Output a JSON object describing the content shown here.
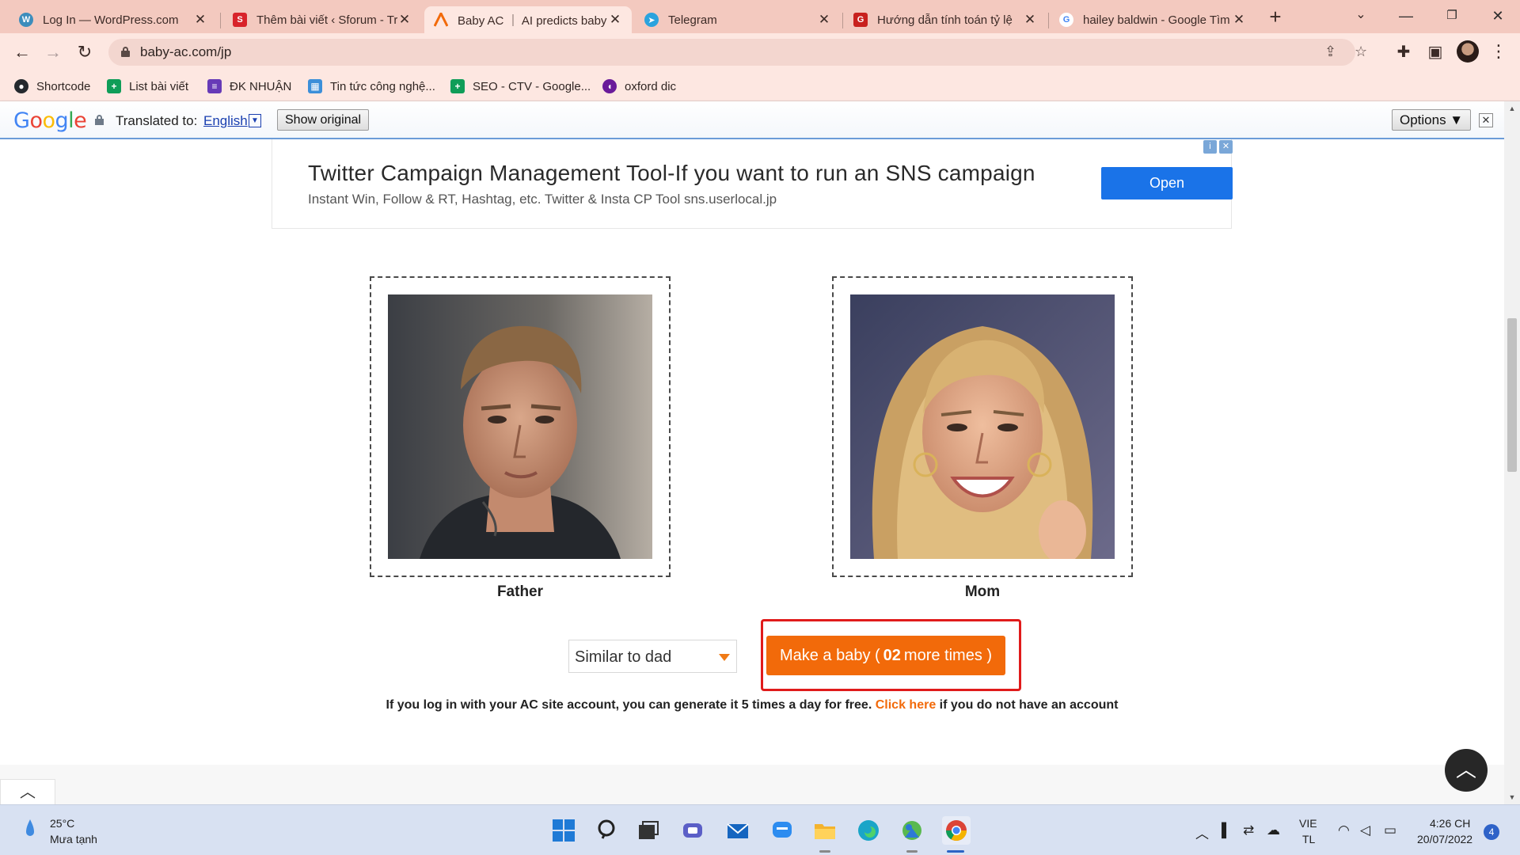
{
  "browser": {
    "tabs": [
      {
        "title": "Log In — WordPress.com",
        "icon": "wordpress-icon",
        "active": false
      },
      {
        "title": "Thêm bài viết ‹ Sforum - Tra",
        "icon": "sforum-icon",
        "active": false
      },
      {
        "title": "Baby AC ｜ AI predicts baby",
        "icon": "baby-ac-icon",
        "active": true
      },
      {
        "title": "Telegram",
        "icon": "telegram-icon",
        "active": false
      },
      {
        "title": "Hướng dẫn tính toán tỷ lệ",
        "icon": "g-icon",
        "active": false
      },
      {
        "title": "hailey baldwin - Google Tìm",
        "icon": "google-icon",
        "active": false
      }
    ],
    "url": "baby-ac.com/jp",
    "bookmarks": [
      {
        "label": "Shortcode",
        "icon": "github-icon"
      },
      {
        "label": "List bài viết",
        "icon": "sheets-icon"
      },
      {
        "label": "ĐK NHUẬN",
        "icon": "forms-icon"
      },
      {
        "label": "Tin tức công nghệ...",
        "icon": "news-icon"
      },
      {
        "label": "SEO - CTV - Google...",
        "icon": "sheets-icon"
      },
      {
        "label": "oxford dic",
        "icon": "oxford-icon"
      }
    ]
  },
  "translate_bar": {
    "logo": "Google",
    "translated_to": "Translated to:",
    "language": "English",
    "show_original": "Show original",
    "options": "Options ▼"
  },
  "ad": {
    "title": "Twitter Campaign Management Tool-If you want to run an SNS campaign",
    "description": "Instant Win, Follow & RT, Hashtag, etc. Twitter & Insta CP Tool sns.userlocal.jp",
    "button": "Open"
  },
  "main": {
    "father_label": "Father",
    "mom_label": "Mom",
    "similarity_select": "Similar to dad",
    "make_baby_prefix": "Make a baby (",
    "make_baby_count": "02",
    "make_baby_suffix": "more times )",
    "login_note_before": "If you log in with your AC site account, you can generate it 5 times a day for free.",
    "login_note_link": "Click here",
    "login_note_after": "if you do not have an account"
  },
  "taskbar": {
    "temperature": "25°C",
    "weather": "Mưa tạnh",
    "lang_top": "VIE",
    "lang_bottom": "TL",
    "time": "4:26 CH",
    "date": "20/07/2022",
    "notification_count": "4"
  },
  "colors": {
    "accent_orange": "#f26a0a",
    "highlight_red": "#e01b1b",
    "chrome_tab": "#f3c9bf",
    "ad_button": "#1a73e8"
  }
}
